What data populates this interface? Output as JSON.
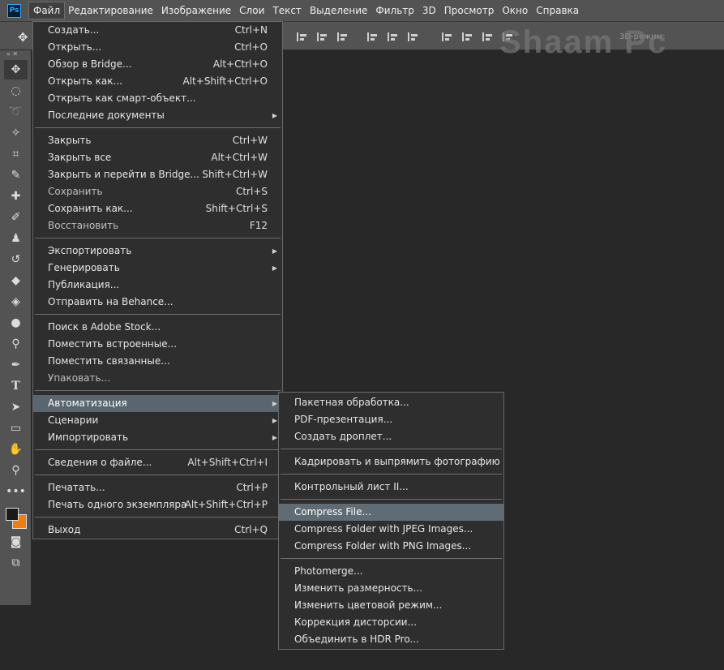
{
  "menubar": {
    "logo": "Ps",
    "items": [
      "Файл",
      "Редактирование",
      "Изображение",
      "Слои",
      "Текст",
      "Выделение",
      "Фильтр",
      "3D",
      "Просмотр",
      "Окно",
      "Справка"
    ]
  },
  "options": {
    "mode3d": "3D-режим:"
  },
  "watermark": "Shaam Pc",
  "file_menu": {
    "groups": [
      [
        {
          "label": "Создать...",
          "shortcut": "Ctrl+N"
        },
        {
          "label": "Открыть...",
          "shortcut": "Ctrl+O"
        },
        {
          "label": "Обзор в Bridge...",
          "shortcut": "Alt+Ctrl+O"
        },
        {
          "label": "Открыть как...",
          "shortcut": "Alt+Shift+Ctrl+O"
        },
        {
          "label": "Открыть как смарт-объект...",
          "shortcut": ""
        },
        {
          "label": "Последние документы",
          "shortcut": "",
          "submenu": true
        }
      ],
      [
        {
          "label": "Закрыть",
          "shortcut": "Ctrl+W"
        },
        {
          "label": "Закрыть все",
          "shortcut": "Alt+Ctrl+W"
        },
        {
          "label": "Закрыть и перейти в Bridge...",
          "shortcut": "Shift+Ctrl+W"
        },
        {
          "label": "Сохранить",
          "shortcut": "Ctrl+S",
          "disabled": true
        },
        {
          "label": "Сохранить как...",
          "shortcut": "Shift+Ctrl+S"
        },
        {
          "label": "Восстановить",
          "shortcut": "F12",
          "disabled": true
        }
      ],
      [
        {
          "label": "Экспортировать",
          "shortcut": "",
          "submenu": true
        },
        {
          "label": "Генерировать",
          "shortcut": "",
          "submenu": true
        },
        {
          "label": "Публикация...",
          "shortcut": ""
        },
        {
          "label": "Отправить на Behance...",
          "shortcut": ""
        }
      ],
      [
        {
          "label": "Поиск в Adobe Stock...",
          "shortcut": ""
        },
        {
          "label": "Поместить встроенные...",
          "shortcut": ""
        },
        {
          "label": "Поместить связанные...",
          "shortcut": ""
        },
        {
          "label": "Упаковать...",
          "shortcut": "",
          "disabled": true
        }
      ],
      [
        {
          "label": "Автоматизация",
          "shortcut": "",
          "submenu": true,
          "highlighted": true
        },
        {
          "label": "Сценарии",
          "shortcut": "",
          "submenu": true
        },
        {
          "label": "Импортировать",
          "shortcut": "",
          "submenu": true
        }
      ],
      [
        {
          "label": "Сведения о файле...",
          "shortcut": "Alt+Shift+Ctrl+I"
        }
      ],
      [
        {
          "label": "Печатать...",
          "shortcut": "Ctrl+P"
        },
        {
          "label": "Печать одного экземпляра",
          "shortcut": "Alt+Shift+Ctrl+P"
        }
      ],
      [
        {
          "label": "Выход",
          "shortcut": "Ctrl+Q"
        }
      ]
    ]
  },
  "automation_menu": {
    "groups": [
      [
        {
          "label": "Пакетная обработка..."
        },
        {
          "label": "PDF-презентация..."
        },
        {
          "label": "Создать дроплет..."
        }
      ],
      [
        {
          "label": "Кадрировать и выпрямить фотографию"
        }
      ],
      [
        {
          "label": "Контрольный лист II..."
        }
      ],
      [
        {
          "label": "Compress File...",
          "highlighted": true
        },
        {
          "label": "Compress Folder with JPEG Images..."
        },
        {
          "label": "Compress Folder with PNG Images..."
        }
      ],
      [
        {
          "label": "Photomerge..."
        },
        {
          "label": "Изменить размерность..."
        },
        {
          "label": "Изменить цветовой режим..."
        },
        {
          "label": "Коррекция дисторсии..."
        },
        {
          "label": "Объединить в HDR Pro..."
        }
      ]
    ]
  },
  "tools": [
    {
      "name": "move-tool",
      "glyph": "✥",
      "selected": true
    },
    {
      "name": "marquee-tool",
      "glyph": "◌"
    },
    {
      "name": "lasso-tool",
      "glyph": "➰"
    },
    {
      "name": "magic-wand-tool",
      "glyph": "✧"
    },
    {
      "name": "crop-tool",
      "glyph": "⌗"
    },
    {
      "name": "eyedropper-tool",
      "glyph": "✎"
    },
    {
      "name": "healing-brush-tool",
      "glyph": "✚"
    },
    {
      "name": "brush-tool",
      "glyph": "✐"
    },
    {
      "name": "clone-stamp-tool",
      "glyph": "♟"
    },
    {
      "name": "history-brush-tool",
      "glyph": "↺"
    },
    {
      "name": "eraser-tool",
      "glyph": "◆"
    },
    {
      "name": "paint-bucket-tool",
      "glyph": "◈"
    },
    {
      "name": "blur-tool",
      "glyph": "●"
    },
    {
      "name": "dodge-tool",
      "glyph": "⚲"
    },
    {
      "name": "pen-tool",
      "glyph": "✒"
    },
    {
      "name": "type-tool",
      "glyph": "T"
    },
    {
      "name": "path-selection-tool",
      "glyph": "➤"
    },
    {
      "name": "rectangle-tool",
      "glyph": "▭"
    },
    {
      "name": "hand-tool",
      "glyph": "✋"
    },
    {
      "name": "zoom-tool",
      "glyph": "⚲"
    },
    {
      "name": "more-tools",
      "glyph": "•••"
    }
  ],
  "colors": {
    "foreground": "#1a1a1a",
    "background": "#ef7e0c",
    "menu_highlight": "#59666f"
  }
}
